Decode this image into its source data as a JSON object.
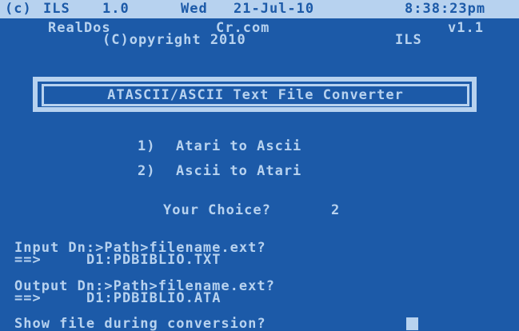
{
  "status_bar": {
    "copyright": "(c)",
    "product": "ILS",
    "version": "1.0",
    "day": "Wed",
    "date": "21-Jul-10",
    "time": "8:38:23pm"
  },
  "header": {
    "app_name": "RealDos",
    "site": "Cr.com",
    "version": "v1.1",
    "copyright_line": "(C)opyright 2010",
    "author": "ILS"
  },
  "title": "ATASCII/ASCII Text File Converter",
  "menu": {
    "options": [
      {
        "key": "1)",
        "label": "Atari to Ascii"
      },
      {
        "key": "2)",
        "label": "Ascii to Atari"
      }
    ]
  },
  "choice": {
    "prompt": "Your Choice?",
    "value": "2"
  },
  "input": {
    "prompt": "Input Dn:>Path>filename.ext?",
    "arrow": "==>",
    "value": "D1:PDBIBLIO.TXT"
  },
  "output": {
    "prompt": "Output Dn:>Path>filename.ext?",
    "arrow": "==>",
    "value": "D1:PDBIBLIO.ATA"
  },
  "show_file": {
    "prompt": "Show file during conversion?"
  },
  "colors": {
    "background": "#1c5aa8",
    "foreground": "#b7d2ef"
  }
}
